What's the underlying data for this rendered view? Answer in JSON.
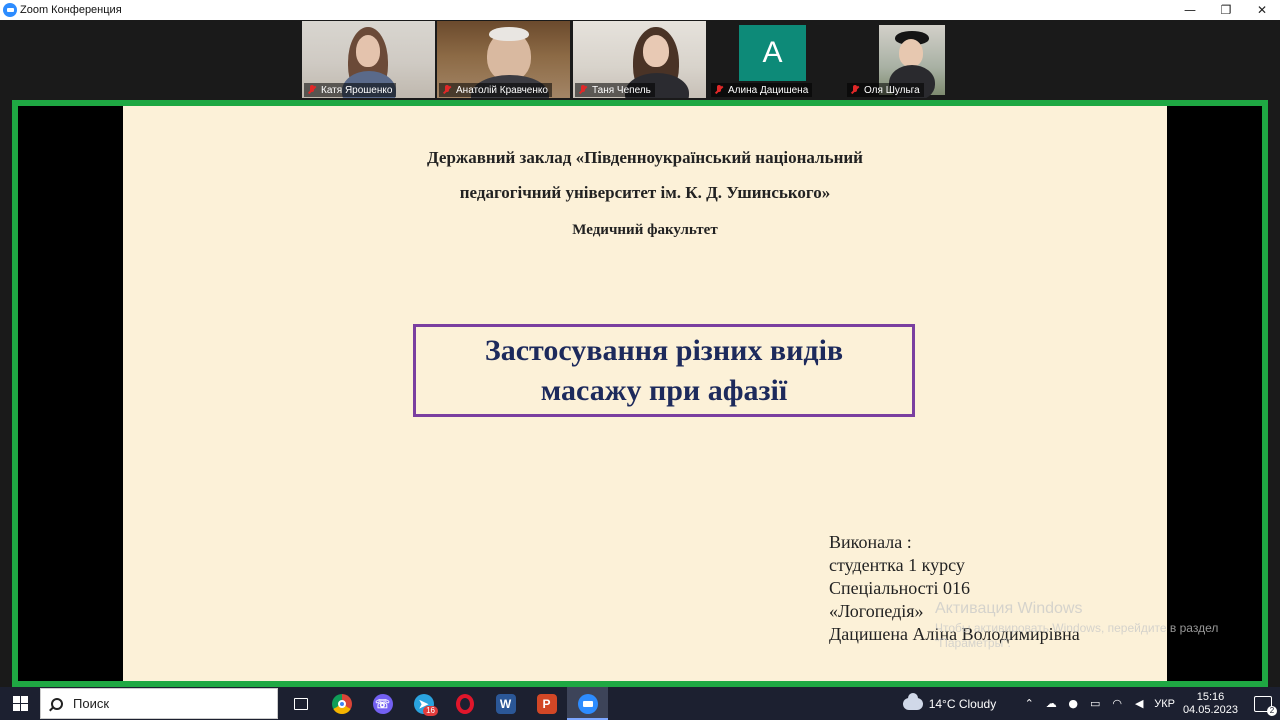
{
  "window": {
    "title": "Zoom Конференция",
    "controls": {
      "minimize": "—",
      "maximize": "❐",
      "close": "✕"
    }
  },
  "gallery": {
    "participants": [
      {
        "name": "Катя Ярошенко",
        "muted": true,
        "video": true
      },
      {
        "name": "Анатолій Кравченко",
        "muted": true,
        "video": true,
        "active_speaker": true
      },
      {
        "name": "Таня Чепель",
        "muted": true,
        "video": true
      },
      {
        "name": "Алина Дацишена",
        "muted": true,
        "video": false,
        "avatar_letter": "A"
      },
      {
        "name": "Оля Шульга",
        "muted": true,
        "video": true
      }
    ]
  },
  "share": {
    "border_color": "#1fa843",
    "slide": {
      "institution_line1": "Державний заклад «Південноукраїнський національний",
      "institution_line2": "педагогічний університет ім. К. Д. Ушинського»",
      "faculty": "Медичний факультет",
      "topic": "Застосування різних видів\nмасажу при афазії",
      "author_lines": [
        "Виконала :",
        "студентка 1 курсу",
        "Спеціальності 016",
        "«Логопедія»",
        "Дацишена Аліна Володимирівна"
      ]
    },
    "watermark": {
      "title": "Активация Windows",
      "subtitle": "Чтобы активировать Windows, перейдите в раздел \"Параметры\"."
    }
  },
  "taskbar": {
    "search_label": "Поиск",
    "apps": [
      {
        "icon": "task-view-icon"
      },
      {
        "icon": "chrome-icon"
      },
      {
        "icon": "viber-icon"
      },
      {
        "icon": "telegram-icon",
        "badge": "16"
      },
      {
        "icon": "opera-icon"
      },
      {
        "icon": "word-icon"
      },
      {
        "icon": "powerpoint-icon"
      },
      {
        "icon": "zoom-icon",
        "active": true
      }
    ],
    "weather": {
      "temp": "14°C",
      "condition": "Cloudy"
    },
    "language": "УКР",
    "time": "15:16",
    "date": "04.05.2023",
    "notifications": "2"
  }
}
